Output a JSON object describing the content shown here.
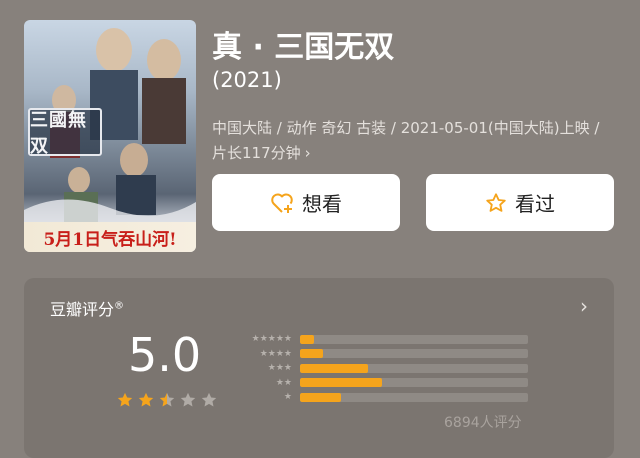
{
  "movie": {
    "title": "真 · 三国无双",
    "year": "(2021)",
    "meta_line": "中国大陆 / 动作 奇幻 古装 / 2021-05-01(中国大陆)上映 / 片长117分钟",
    "meta_chevron": "›",
    "poster": {
      "logo_text": "三國無双",
      "banner_text": "5月1日气吞山河!"
    }
  },
  "actions": {
    "want_label": "想看",
    "seen_label": "看过",
    "want_icon": "heart-plus-icon",
    "seen_icon": "star-outline-icon"
  },
  "rating": {
    "label": "豆瓣评分",
    "label_mark": "®",
    "score": "5.0",
    "stars_filled": 2.5,
    "stars_total": 5,
    "distribution": [
      {
        "stars": 5,
        "fraction": 0.06
      },
      {
        "stars": 4,
        "fraction": 0.1
      },
      {
        "stars": 3,
        "fraction": 0.3
      },
      {
        "stars": 2,
        "fraction": 0.36
      },
      {
        "stars": 1,
        "fraction": 0.18
      }
    ],
    "count_text": "6894人评分",
    "arrow": "›"
  },
  "colors": {
    "background": "#87817c",
    "card": "#7b7570",
    "accent": "#f5a41c"
  }
}
